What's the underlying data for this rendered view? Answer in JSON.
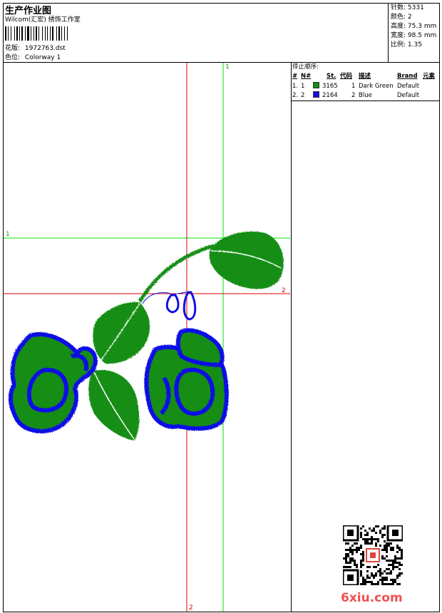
{
  "header": {
    "title": "生产作业图",
    "company": "Wilcom(汇宏) 绣饰工作室",
    "design_label": "花版:",
    "design_value": "1972763.dst",
    "color_label": "色位:",
    "color_value": "Colorway 1"
  },
  "specs": [
    {
      "label": "针数:",
      "value": "5331"
    },
    {
      "label": "颜色:",
      "value": "2"
    },
    {
      "label": "高度:",
      "value": "75.3 mm"
    },
    {
      "label": "宽度:",
      "value": "98.5 mm"
    },
    {
      "label": "比例:",
      "value": "1.35"
    }
  ],
  "stop_sequence": {
    "title": "停止顺序:",
    "headers": {
      "num": "#",
      "needle": "N#",
      "st": "St.",
      "code": "代码",
      "desc": "描述",
      "brand": "Brand",
      "element": "元素"
    },
    "rows": [
      {
        "num": "1.",
        "needle": "1",
        "color": "#138e13",
        "st": "3165",
        "code": "1",
        "desc": "Dark Green",
        "brand": "Default"
      },
      {
        "num": "2.",
        "needle": "2",
        "color": "#1010e6",
        "st": "2164",
        "code": "2",
        "desc": "Blue",
        "brand": "Default"
      }
    ]
  },
  "guides": {
    "green_v": "1",
    "green_h": "1",
    "red_h": "2",
    "red_v": "2"
  },
  "colors": {
    "green_thread": "#138e13",
    "blue_thread": "#1010e6",
    "guide_green": "#00e000",
    "guide_red": "#e00000"
  },
  "watermark": {
    "text": "6xiu.com"
  }
}
